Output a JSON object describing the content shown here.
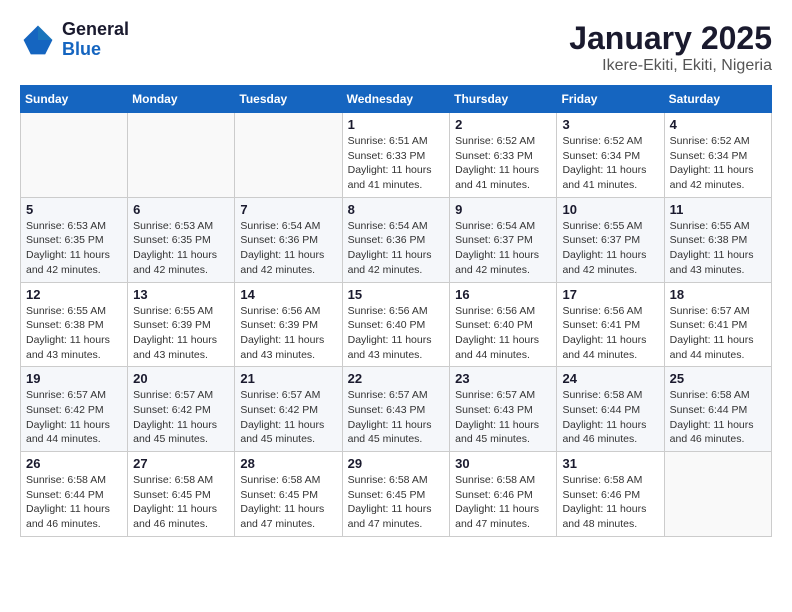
{
  "header": {
    "logo_general": "General",
    "logo_blue": "Blue",
    "title": "January 2025",
    "subtitle": "Ikere-Ekiti, Ekiti, Nigeria"
  },
  "weekdays": [
    "Sunday",
    "Monday",
    "Tuesday",
    "Wednesday",
    "Thursday",
    "Friday",
    "Saturday"
  ],
  "weeks": [
    [
      {
        "day": "",
        "info": ""
      },
      {
        "day": "",
        "info": ""
      },
      {
        "day": "",
        "info": ""
      },
      {
        "day": "1",
        "info": "Sunrise: 6:51 AM\nSunset: 6:33 PM\nDaylight: 11 hours\nand 41 minutes."
      },
      {
        "day": "2",
        "info": "Sunrise: 6:52 AM\nSunset: 6:33 PM\nDaylight: 11 hours\nand 41 minutes."
      },
      {
        "day": "3",
        "info": "Sunrise: 6:52 AM\nSunset: 6:34 PM\nDaylight: 11 hours\nand 41 minutes."
      },
      {
        "day": "4",
        "info": "Sunrise: 6:52 AM\nSunset: 6:34 PM\nDaylight: 11 hours\nand 42 minutes."
      }
    ],
    [
      {
        "day": "5",
        "info": "Sunrise: 6:53 AM\nSunset: 6:35 PM\nDaylight: 11 hours\nand 42 minutes."
      },
      {
        "day": "6",
        "info": "Sunrise: 6:53 AM\nSunset: 6:35 PM\nDaylight: 11 hours\nand 42 minutes."
      },
      {
        "day": "7",
        "info": "Sunrise: 6:54 AM\nSunset: 6:36 PM\nDaylight: 11 hours\nand 42 minutes."
      },
      {
        "day": "8",
        "info": "Sunrise: 6:54 AM\nSunset: 6:36 PM\nDaylight: 11 hours\nand 42 minutes."
      },
      {
        "day": "9",
        "info": "Sunrise: 6:54 AM\nSunset: 6:37 PM\nDaylight: 11 hours\nand 42 minutes."
      },
      {
        "day": "10",
        "info": "Sunrise: 6:55 AM\nSunset: 6:37 PM\nDaylight: 11 hours\nand 42 minutes."
      },
      {
        "day": "11",
        "info": "Sunrise: 6:55 AM\nSunset: 6:38 PM\nDaylight: 11 hours\nand 43 minutes."
      }
    ],
    [
      {
        "day": "12",
        "info": "Sunrise: 6:55 AM\nSunset: 6:38 PM\nDaylight: 11 hours\nand 43 minutes."
      },
      {
        "day": "13",
        "info": "Sunrise: 6:55 AM\nSunset: 6:39 PM\nDaylight: 11 hours\nand 43 minutes."
      },
      {
        "day": "14",
        "info": "Sunrise: 6:56 AM\nSunset: 6:39 PM\nDaylight: 11 hours\nand 43 minutes."
      },
      {
        "day": "15",
        "info": "Sunrise: 6:56 AM\nSunset: 6:40 PM\nDaylight: 11 hours\nand 43 minutes."
      },
      {
        "day": "16",
        "info": "Sunrise: 6:56 AM\nSunset: 6:40 PM\nDaylight: 11 hours\nand 44 minutes."
      },
      {
        "day": "17",
        "info": "Sunrise: 6:56 AM\nSunset: 6:41 PM\nDaylight: 11 hours\nand 44 minutes."
      },
      {
        "day": "18",
        "info": "Sunrise: 6:57 AM\nSunset: 6:41 PM\nDaylight: 11 hours\nand 44 minutes."
      }
    ],
    [
      {
        "day": "19",
        "info": "Sunrise: 6:57 AM\nSunset: 6:42 PM\nDaylight: 11 hours\nand 44 minutes."
      },
      {
        "day": "20",
        "info": "Sunrise: 6:57 AM\nSunset: 6:42 PM\nDaylight: 11 hours\nand 45 minutes."
      },
      {
        "day": "21",
        "info": "Sunrise: 6:57 AM\nSunset: 6:42 PM\nDaylight: 11 hours\nand 45 minutes."
      },
      {
        "day": "22",
        "info": "Sunrise: 6:57 AM\nSunset: 6:43 PM\nDaylight: 11 hours\nand 45 minutes."
      },
      {
        "day": "23",
        "info": "Sunrise: 6:57 AM\nSunset: 6:43 PM\nDaylight: 11 hours\nand 45 minutes."
      },
      {
        "day": "24",
        "info": "Sunrise: 6:58 AM\nSunset: 6:44 PM\nDaylight: 11 hours\nand 46 minutes."
      },
      {
        "day": "25",
        "info": "Sunrise: 6:58 AM\nSunset: 6:44 PM\nDaylight: 11 hours\nand 46 minutes."
      }
    ],
    [
      {
        "day": "26",
        "info": "Sunrise: 6:58 AM\nSunset: 6:44 PM\nDaylight: 11 hours\nand 46 minutes."
      },
      {
        "day": "27",
        "info": "Sunrise: 6:58 AM\nSunset: 6:45 PM\nDaylight: 11 hours\nand 46 minutes."
      },
      {
        "day": "28",
        "info": "Sunrise: 6:58 AM\nSunset: 6:45 PM\nDaylight: 11 hours\nand 47 minutes."
      },
      {
        "day": "29",
        "info": "Sunrise: 6:58 AM\nSunset: 6:45 PM\nDaylight: 11 hours\nand 47 minutes."
      },
      {
        "day": "30",
        "info": "Sunrise: 6:58 AM\nSunset: 6:46 PM\nDaylight: 11 hours\nand 47 minutes."
      },
      {
        "day": "31",
        "info": "Sunrise: 6:58 AM\nSunset: 6:46 PM\nDaylight: 11 hours\nand 48 minutes."
      },
      {
        "day": "",
        "info": ""
      }
    ]
  ]
}
